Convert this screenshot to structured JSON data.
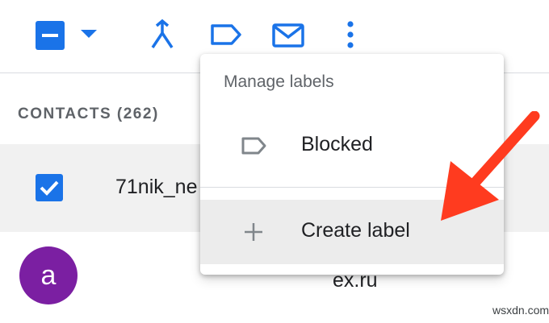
{
  "toolbar": {
    "select_all_icon": "minus-checkbox-icon",
    "select_dropdown_icon": "caret-down-icon",
    "merge_icon": "merge-icon",
    "label_icon": "label-icon",
    "email_icon": "mail-icon",
    "more_icon": "more-vert-icon"
  },
  "contacts": {
    "header": "CONTACTS (262)",
    "rows": [
      {
        "name": "71nik_ne",
        "checked": true
      },
      {
        "avatar_letter": "a",
        "email_partial": "ex.ru",
        "avatar_color": "#7b1fa2"
      }
    ]
  },
  "label_menu": {
    "title": "Manage labels",
    "items": [
      {
        "label": "Blocked",
        "icon": "label-outline-icon"
      },
      {
        "label": "Create label",
        "icon": "plus-icon"
      }
    ]
  },
  "annotation": {
    "arrow_color": "#ff3b1f"
  },
  "watermark": "wsxdn.com",
  "colors": {
    "accent": "#1a73e8",
    "muted": "#5f6368",
    "divider": "#dadce0"
  }
}
